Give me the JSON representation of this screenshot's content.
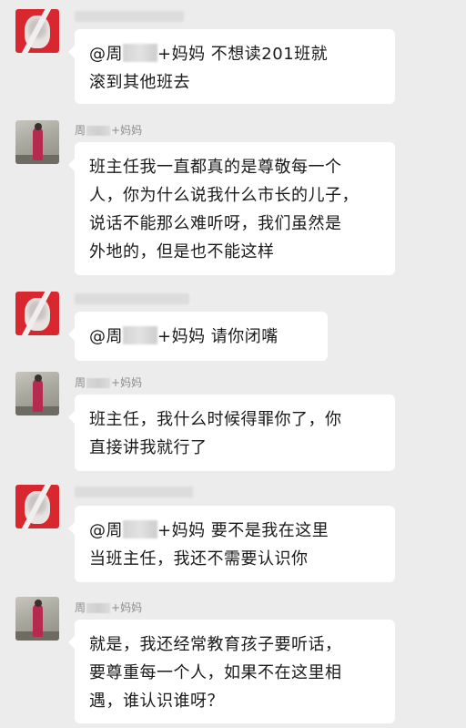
{
  "chat": {
    "messages": [
      {
        "sender": "teacher",
        "name": "",
        "lines": [
          "@周",
          "+妈妈  不想读201班就",
          "滚到其他班去"
        ]
      },
      {
        "sender": "parent",
        "name_pre": "周",
        "name_post": "+妈妈",
        "lines": [
          "班主任我一直都真的是尊敬每一个",
          "人，你为什么说我什么市长的儿子，",
          "说话不能那么难听呀，我们虽然是",
          "外地的，但是也不能这样"
        ]
      },
      {
        "sender": "teacher",
        "name": "",
        "lines": [
          "@周",
          "+妈妈  请你闭嘴"
        ]
      },
      {
        "sender": "parent",
        "name_pre": "周",
        "name_post": "+妈妈",
        "lines": [
          "班主任，我什么时候得罪你了，你",
          "直接讲我就行了"
        ]
      },
      {
        "sender": "teacher",
        "name": "",
        "lines": [
          "@周",
          "+妈妈  要不是我在这里",
          "当班主任，我还不需要认识你"
        ]
      },
      {
        "sender": "parent",
        "name_pre": "周",
        "name_post": "+妈妈",
        "lines": [
          "就是，我还经常教育孩子要听话，",
          "要尊重每一个人，如果不在这里相",
          "遇，谁认识谁呀？"
        ]
      }
    ]
  }
}
